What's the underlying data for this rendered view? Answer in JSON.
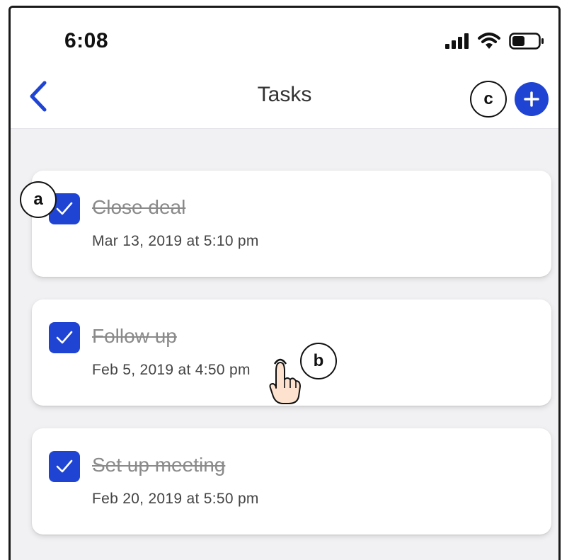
{
  "status_bar": {
    "time": "6:08",
    "icons": [
      "signal-icon",
      "wifi-icon",
      "battery-icon"
    ]
  },
  "header": {
    "title": "Tasks",
    "back_icon": "chevron-left-icon",
    "add_icon": "plus-icon"
  },
  "tasks": [
    {
      "title": "Close deal",
      "date": "Mar 13, 2019 at 5:10 pm",
      "completed": true
    },
    {
      "title": "Follow up",
      "date": "Feb 5, 2019 at 4:50 pm",
      "completed": true
    },
    {
      "title": "Set up meeting",
      "date": "Feb 20, 2019 at 5:50 pm",
      "completed": true
    }
  ],
  "markers": {
    "a": "a",
    "b": "b",
    "c": "c"
  },
  "colors": {
    "accent": "#1f44d4",
    "background": "#f1f1f3",
    "card": "#ffffff",
    "completed_text": "#8a8a8a"
  }
}
